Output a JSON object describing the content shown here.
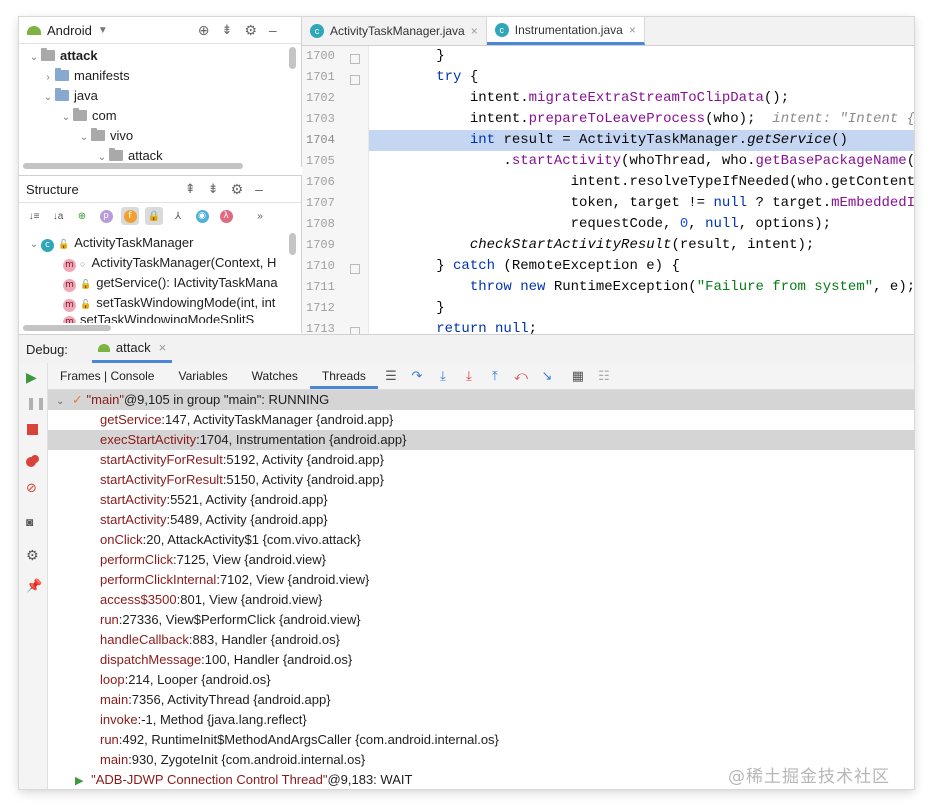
{
  "project": {
    "selector": "Android",
    "tree": [
      {
        "label": "attack",
        "level": 0,
        "bold": true
      },
      {
        "label": "manifests",
        "level": 1,
        "chev": "›"
      },
      {
        "label": "java",
        "level": 1,
        "chev": "⌄"
      },
      {
        "label": "com",
        "level": 2,
        "chev": "⌄"
      },
      {
        "label": "vivo",
        "level": 3,
        "chev": "⌄"
      },
      {
        "label": "attack",
        "level": 4,
        "chev": "⌄"
      }
    ]
  },
  "structure": {
    "title": "Structure",
    "class_name": "ActivityTaskManager",
    "items": [
      "ActivityTaskManager(Context, H",
      "getService(): IActivityTaskMana",
      "setTaskWindowingMode(int, int",
      "setTaskWindowingModeSplitS"
    ]
  },
  "editor": {
    "tabs": [
      "ActivityTaskManager.java",
      "Instrumentation.java"
    ],
    "active_tab": 1,
    "line_numbers": [
      "1700",
      "1701",
      "1702",
      "1703",
      "1704",
      "1705",
      "1706",
      "1707",
      "1708",
      "1709",
      "1710",
      "1711",
      "1712",
      "1713"
    ],
    "highlight_line": "1704",
    "lines": {
      "l1700": "        }",
      "l1701_kw": "try",
      "l1701_rest": " {",
      "l1702_a": "            intent.",
      "l1702_fn": "migrateExtraStreamToClipData",
      "l1702_b": "();",
      "l1703_a": "            intent.",
      "l1703_fn": "prepareToLeaveProcess",
      "l1703_b": "(who);  ",
      "l1703_hint": "intent: \"Intent { a",
      "l1704_kw": "int",
      "l1704_a": " result = ActivityTaskManager.",
      "l1704_it": "getService",
      "l1704_b": "()",
      "l1705_a": "                .",
      "l1705_fn": "startActivity",
      "l1705_b": "(whoThread, who.",
      "l1705_fn2": "getBasePackageName",
      "l1705_c": "(),",
      "l1706": "                        intent.resolveTypeIfNeeded(who.getContentRe",
      "l1707_a": "                        token, target != ",
      "l1707_kw": "null",
      "l1707_b": " ? target.",
      "l1707_fn": "mEmbeddedID",
      "l1708_a": "                        requestCode, ",
      "l1708_num": "0",
      "l1708_b": ", ",
      "l1708_kw": "null",
      "l1708_c": ", options);",
      "l1709_it": "checkStartActivityResult",
      "l1709_b": "(result, intent);",
      "l1710_a": "        } ",
      "l1710_kw": "catch",
      "l1710_b": " (RemoteException e) {",
      "l1711_kw": "throw new",
      "l1711_a": " RuntimeException(",
      "l1711_str": "\"Failure from system\"",
      "l1711_b": ", e);",
      "l1712": "        }",
      "l1713_kw": "return null",
      "l1713_b": ";"
    }
  },
  "debug": {
    "label": "Debug:",
    "config": "attack",
    "tabs": [
      "Frames | Console",
      "Variables",
      "Watches",
      "Threads"
    ],
    "active_tab": 3,
    "thread_main": {
      "name": "\"main\"",
      "info": "@9,105 in group \"main\": RUNNING"
    },
    "frames": [
      {
        "method": "getService",
        "detail": ":147, ActivityTaskManager {android.app}"
      },
      {
        "method": "execStartActivity",
        "detail": ":1704, Instrumentation {android.app}"
      },
      {
        "method": "startActivityForResult",
        "detail": ":5192, Activity {android.app}"
      },
      {
        "method": "startActivityForResult",
        "detail": ":5150, Activity {android.app}"
      },
      {
        "method": "startActivity",
        "detail": ":5521, Activity {android.app}"
      },
      {
        "method": "startActivity",
        "detail": ":5489, Activity {android.app}"
      },
      {
        "method": "onClick",
        "detail": ":20, AttackActivity$1 {com.vivo.attack}"
      },
      {
        "method": "performClick",
        "detail": ":7125, View {android.view}"
      },
      {
        "method": "performClickInternal",
        "detail": ":7102, View {android.view}"
      },
      {
        "method": "access$3500",
        "detail": ":801, View {android.view}"
      },
      {
        "method": "run",
        "detail": ":27336, View$PerformClick {android.view}"
      },
      {
        "method": "handleCallback",
        "detail": ":883, Handler {android.os}"
      },
      {
        "method": "dispatchMessage",
        "detail": ":100, Handler {android.os}"
      },
      {
        "method": "loop",
        "detail": ":214, Looper {android.os}"
      },
      {
        "method": "main",
        "detail": ":7356, ActivityThread {android.app}"
      },
      {
        "method": "invoke",
        "detail": ":-1, Method {java.lang.reflect}"
      },
      {
        "method": "run",
        "detail": ":492, RuntimeInit$MethodAndArgsCaller {com.android.internal.os}"
      },
      {
        "method": "main",
        "detail": ":930, ZygoteInit {com.android.internal.os}"
      }
    ],
    "selected_frame": 1,
    "thread_other": {
      "name": "\"ADB-JDWP Connection Control Thread\"",
      "info": "@9,183: WAIT"
    }
  },
  "watermark": "@稀土掘金技术社区",
  "colors": {
    "selection": "#c5d6f2",
    "frame_selected": "#d5d5d5",
    "accent": "#4a87d8",
    "method": "#8b1a1a"
  }
}
